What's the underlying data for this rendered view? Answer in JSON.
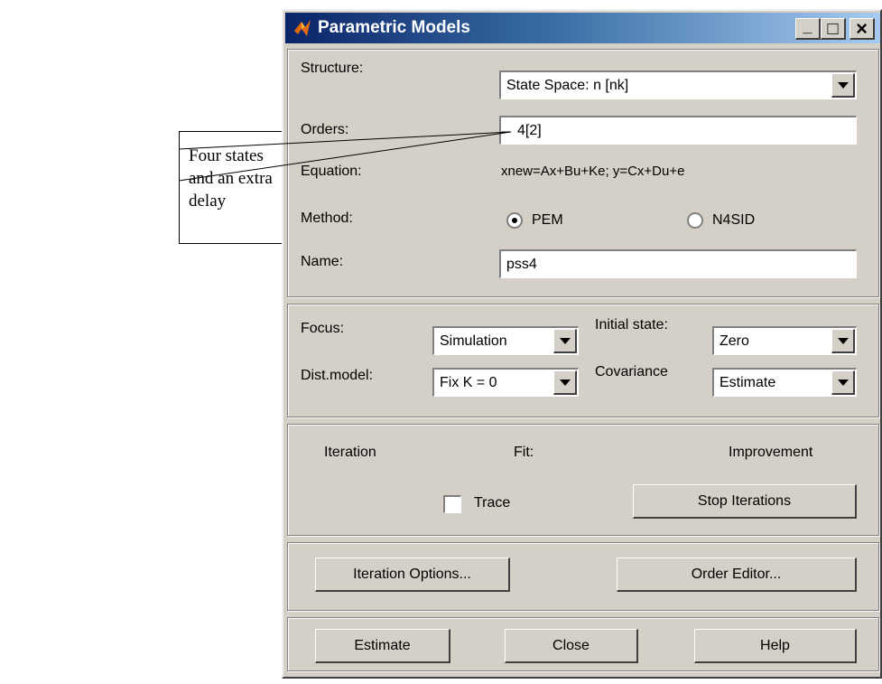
{
  "callout": {
    "lines": [
      "Four states",
      "and an extra",
      "delay"
    ]
  },
  "window": {
    "title": "Parametric Models",
    "minimize": "_",
    "maximize": "□",
    "close": "×"
  },
  "structure": {
    "label": "Structure:",
    "value": "State Space: n [nk]"
  },
  "orders": {
    "label": "Orders:",
    "value": "4[2]"
  },
  "equation": {
    "label": "Equation:",
    "value": "xnew=Ax+Bu+Ke; y=Cx+Du+e"
  },
  "method": {
    "label": "Method:",
    "options": [
      "PEM",
      "N4SID"
    ],
    "selected": "PEM"
  },
  "name": {
    "label": "Name:",
    "value": "pss4"
  },
  "focus": {
    "label": "Focus:",
    "value": "Simulation"
  },
  "initial_state": {
    "label": "Initial state:",
    "value": "Zero"
  },
  "dist_model": {
    "label": "Dist.model:",
    "value": "Fix K = 0"
  },
  "covariance": {
    "label": "Covariance",
    "value": "Estimate"
  },
  "iteration": {
    "headers": [
      "Iteration",
      "Fit:",
      "Improvement"
    ],
    "trace_label": "Trace",
    "trace_checked": false,
    "stop_button": "Stop Iterations"
  },
  "options_buttons": {
    "iteration_options": "Iteration Options...",
    "order_editor": "Order Editor..."
  },
  "footer_buttons": {
    "estimate": "Estimate",
    "close": "Close",
    "help": "Help"
  }
}
